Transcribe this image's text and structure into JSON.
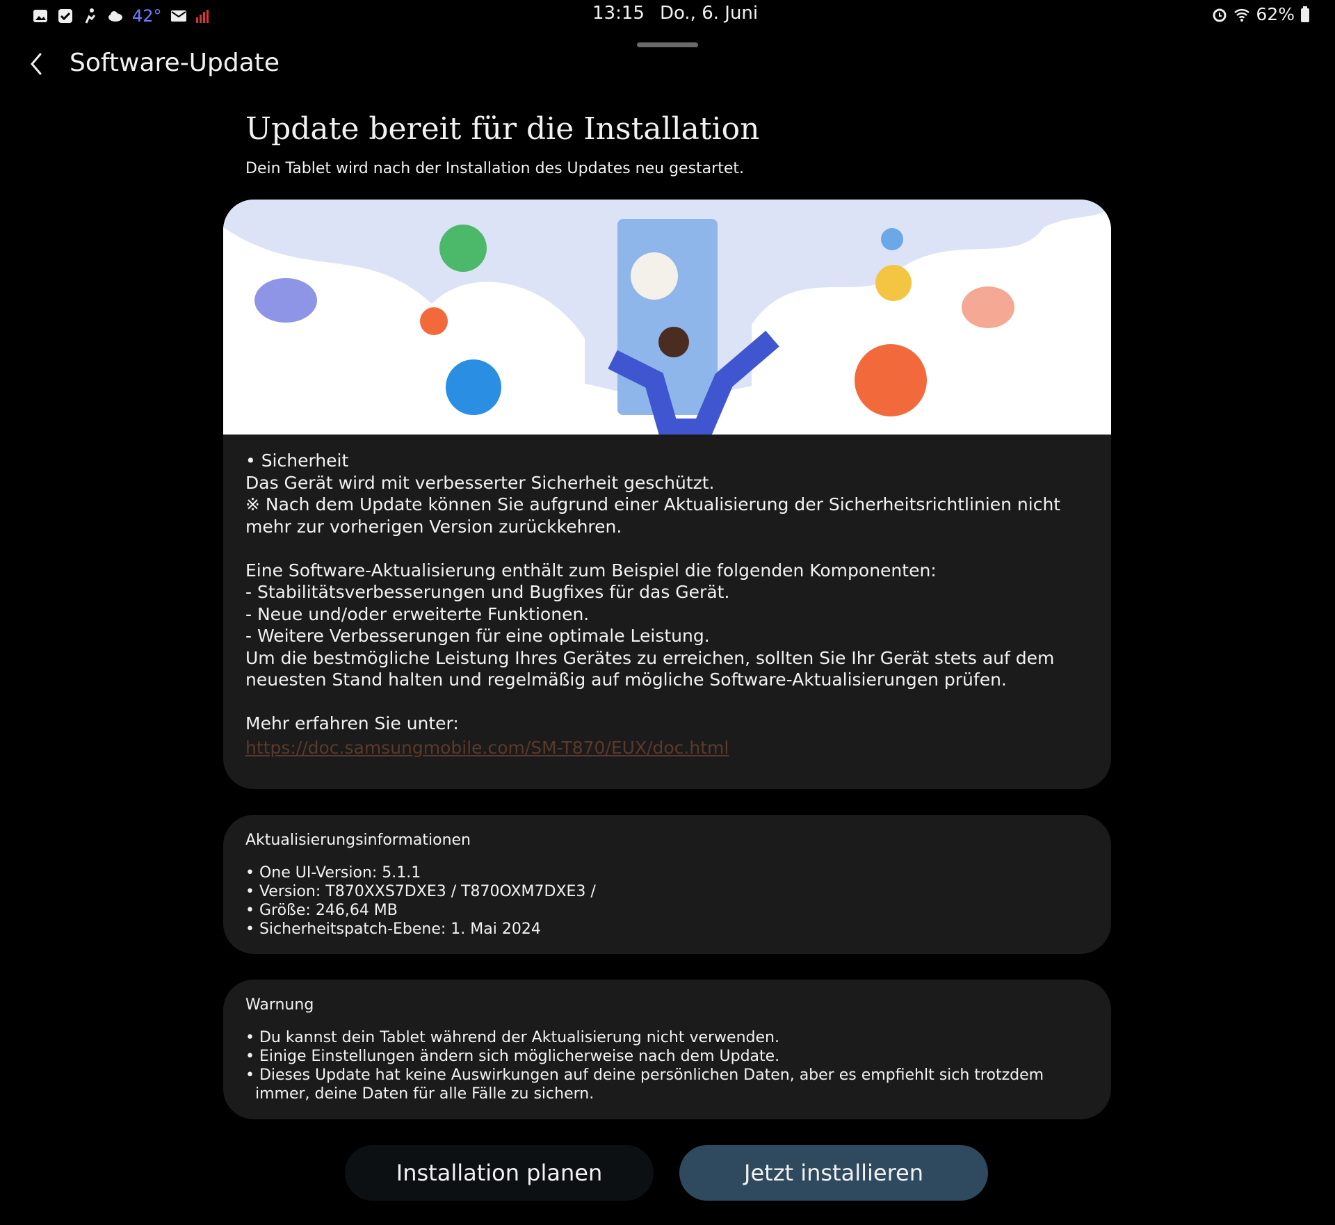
{
  "status_bar": {
    "temperature": "42°",
    "time": "13:15",
    "date": "Do., 6. Juni",
    "battery": "62%"
  },
  "app_bar": {
    "title": "Software-Update"
  },
  "header": {
    "headline": "Update bereit für die Installation",
    "subline": "Dein Tablet wird nach der Installation des Updates neu gestartet."
  },
  "notes": {
    "body": "• Sicherheit\nDas Gerät wird mit verbesserter Sicherheit geschützt.\n※ Nach dem Update können Sie aufgrund einer Aktualisierung der Sicherheitsrichtlinien nicht mehr zur vorherigen Version zurückkehren.\n\nEine Software-Aktualisierung enthält zum Beispiel die folgenden Komponenten:\n - Stabilitätsverbesserungen und Bugfixes für das Gerät.\n - Neue und/oder erweiterte Funktionen.\n - Weitere Verbesserungen für eine optimale Leistung.\nUm die bestmögliche Leistung Ihres Gerätes zu erreichen, sollten Sie Ihr Gerät stets auf dem neuesten Stand halten und regelmäßig auf mögliche Software-Aktualisierungen prüfen.\n\nMehr erfahren Sie unter:",
    "link": "https://doc.samsungmobile.com/SM-T870/EUX/doc.html"
  },
  "info": {
    "title": "Aktualisierungsinformationen",
    "items": [
      "• One UI-Version: 5.1.1",
      "• Version: T870XXS7DXE3 / T870OXM7DXE3 /",
      "• Größe: 246,64 MB",
      "• Sicherheitspatch-Ebene: 1. Mai 2024"
    ]
  },
  "warning": {
    "title": "Warnung",
    "items": [
      "• Du kannst dein Tablet während der Aktualisierung nicht verwenden.",
      "• Einige Einstellungen ändern sich möglicherweise nach dem Update.",
      "• Dieses Update hat keine Auswirkungen auf deine persönlichen Daten, aber es empfiehlt sich trotzdem immer, deine Daten für alle Fälle zu sichern."
    ]
  },
  "buttons": {
    "plan": "Installation planen",
    "install": "Jetzt installieren"
  },
  "colors": {
    "background": "#000000",
    "card": "#1b1b1b",
    "primary_button": "#2f4a5e",
    "link": "#5a3a2a"
  }
}
